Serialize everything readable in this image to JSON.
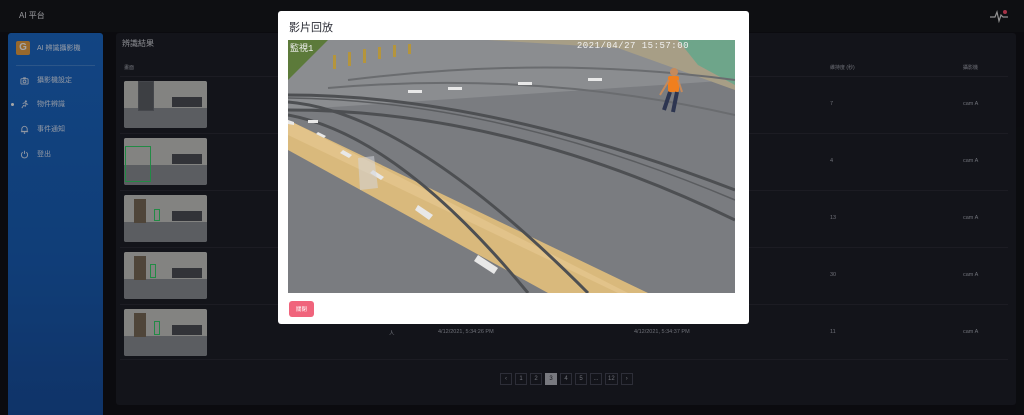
{
  "app": {
    "title": "AI 平台"
  },
  "sidebar": {
    "logo_text": "AI 辨識攝影機",
    "items": [
      {
        "label": "攝影機設定",
        "icon": "camera-icon"
      },
      {
        "label": "物件辨識",
        "icon": "run-icon",
        "active": true
      },
      {
        "label": "事件通知",
        "icon": "bell-icon"
      },
      {
        "label": "登出",
        "icon": "power-icon"
      }
    ]
  },
  "results": {
    "title": "辨識結果",
    "columns": [
      "畫面",
      "維持度 (秒)",
      "攝影機"
    ],
    "rows": [
      {
        "duration": "7",
        "camera": "cam A"
      },
      {
        "duration": "4",
        "camera": "cam A"
      },
      {
        "duration": "13",
        "camera": "cam A"
      },
      {
        "duration": "30",
        "camera": "cam A"
      },
      {
        "type": "人",
        "start": "4/12/2021, 5:34:26 PM",
        "end": "4/12/2021, 5:34:37 PM",
        "duration": "11",
        "camera": "cam A"
      }
    ]
  },
  "pagination": {
    "prev": "‹",
    "pages": [
      "1",
      "2",
      "3",
      "4",
      "5",
      "...",
      "12"
    ],
    "next": "›",
    "current": "3"
  },
  "modal": {
    "title": "影片回放",
    "timestamp": "2021/04/27 15:57:00",
    "camera_osd": "監視1",
    "close_label": "關閉"
  },
  "colors": {
    "sidebar": "#1c6ac9",
    "close_button": "#f0647c",
    "detection_box": "#35d46a"
  }
}
